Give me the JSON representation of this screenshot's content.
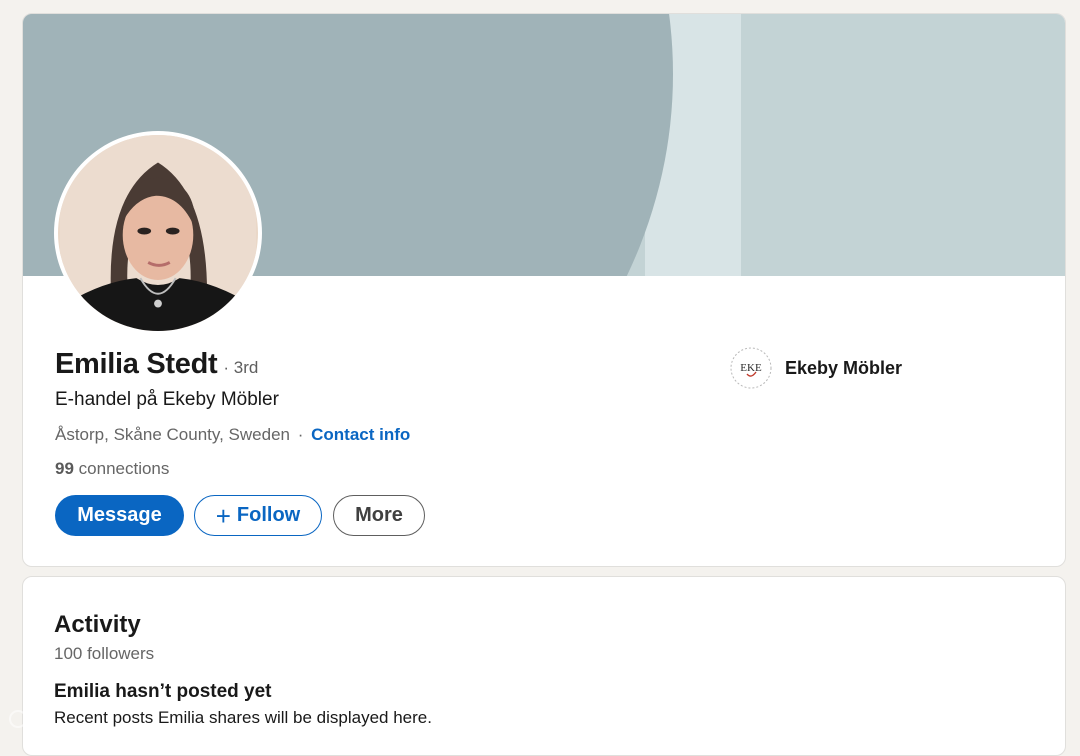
{
  "profile": {
    "name": "Emilia Stedt",
    "degree": "· 3rd",
    "headline": "E-handel på Ekeby Möbler",
    "location": "Åstorp, Skåne County, Sweden",
    "separator": "·",
    "contact_info_label": "Contact info",
    "connections_count": "99",
    "connections_label": "connections",
    "avatar_icon": "profile-photo"
  },
  "actions": {
    "message_label": "Message",
    "follow_plus": "+",
    "follow_label": "Follow",
    "more_label": "More"
  },
  "company": {
    "name": "Ekeby Möbler",
    "logo_text": "EKE"
  },
  "activity": {
    "title": "Activity",
    "followers": "100 followers",
    "empty_title": "Emilia hasn’t posted yet",
    "empty_desc": "Recent posts Emilia shares will be displayed here."
  },
  "colors": {
    "accent": "#0a66c2",
    "banner_light": "#c3d3d5",
    "banner_dark": "#a0b3b8",
    "page_bg": "#f4f2ee"
  }
}
